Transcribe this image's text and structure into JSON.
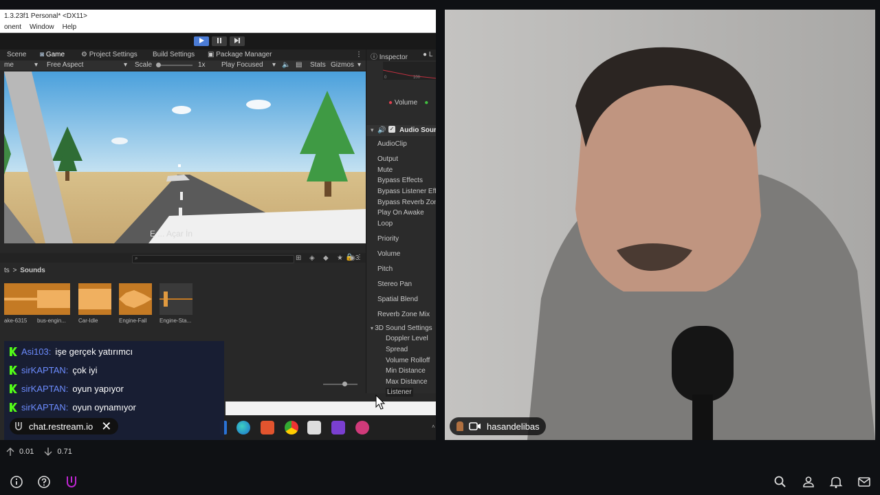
{
  "unity": {
    "title": "1.3.23f1 Personal* <DX11>",
    "menu": [
      "onent",
      "Window",
      "Help"
    ],
    "tabs": [
      "Scene",
      "Game",
      "Project Settings",
      "Build Settings",
      "Package Manager"
    ],
    "game_toolbar": {
      "display": "me",
      "aspect": "Free Aspect",
      "scale_label": "Scale",
      "scale_value": "1x",
      "play_mode": "Play Focused",
      "stats": "Stats",
      "gizmos": "Gizmos"
    },
    "game_overlay_text": "E ... Açar İn",
    "breadcrumb": {
      "parent": "ts",
      "separator": ">",
      "current": "Sounds"
    },
    "assets": [
      "ake-6315",
      "bus-engin...",
      "Car-Idle",
      "Engine-Fall",
      "Engine-Sta..."
    ],
    "project_count": "3",
    "inspector": {
      "tab_label": "Inspector",
      "tab2_label": "L",
      "curve_ticks": [
        "0",
        "100"
      ],
      "volume_curve_label": "Volume",
      "component_title": "Audio Sour",
      "properties": [
        "AudioClip",
        "Output",
        "Mute",
        "Bypass Effects",
        "Bypass Listener Eff",
        "Bypass Reverb Zon",
        "Play On Awake",
        "Loop",
        "Priority",
        "Volume",
        "Pitch",
        "Stereo Pan",
        "Spatial Blend",
        "Reverb Zone Mix"
      ],
      "section_3d": "3D Sound Settings",
      "sub_properties": [
        "Doppler Level",
        "Spread",
        "Volume Rolloff",
        "Min Distance",
        "Max Distance"
      ],
      "listener": "Listener"
    }
  },
  "chat": {
    "messages": [
      {
        "user": "Asi103:",
        "text": "işe gerçek yatırımcı"
      },
      {
        "user": "sirKAPTAN:",
        "text": "çok iyi"
      },
      {
        "user": "sirKAPTAN:",
        "text": "oyun yapıyor"
      },
      {
        "user": "sirKAPTAN:",
        "text": "oyun oynamıyor"
      }
    ],
    "badge": "chat.restream.io"
  },
  "webcam": {
    "name": "hasandelibas"
  },
  "stats": {
    "up": "0.01",
    "down": "0.71"
  },
  "colors": {
    "accent": "#c026d3",
    "kick_green": "#53fc18",
    "chat_user": "#6c8cff"
  }
}
